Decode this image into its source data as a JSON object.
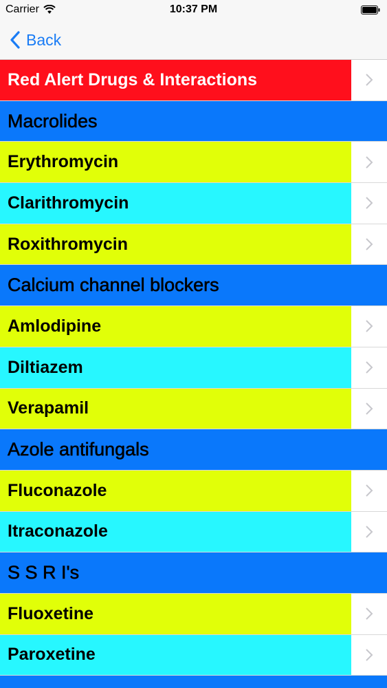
{
  "status_bar": {
    "carrier": "Carrier",
    "time": "10:37 PM"
  },
  "nav": {
    "back_label": "Back"
  },
  "colors": {
    "red": "#ff0f1c",
    "header_blue": "#0a78fb",
    "yellow": "#e1ff08",
    "cyan": "#27f7ff",
    "back_blue": "#1a7cf5"
  },
  "list": {
    "red_alert": "Red Alert Drugs & Interactions",
    "sections": [
      {
        "title": "Macrolides",
        "items": [
          "Erythromycin",
          "Clarithromycin",
          "Roxithromycin"
        ]
      },
      {
        "title": "Calcium channel blockers",
        "items": [
          "Amlodipine",
          "Diltiazem",
          "Verapamil"
        ]
      },
      {
        "title": "Azole antifungals",
        "items": [
          "Fluconazole",
          "Itraconazole"
        ]
      },
      {
        "title": "S S R I's",
        "items": [
          "Fluoxetine",
          "Paroxetine"
        ]
      }
    ]
  }
}
